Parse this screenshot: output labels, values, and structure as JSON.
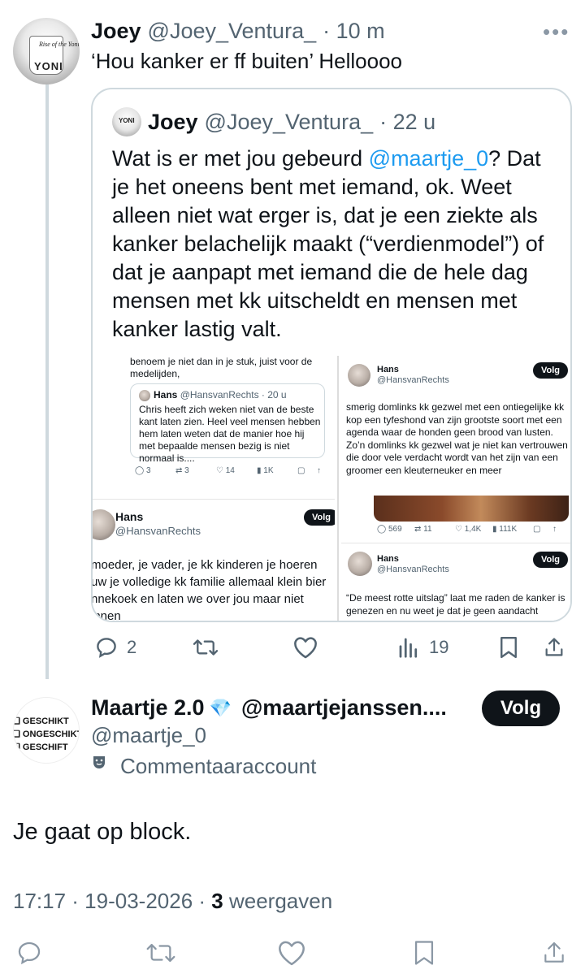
{
  "tweet": {
    "name": "Joey",
    "handle": "@Joey_Ventura_",
    "time": "· 10 m",
    "more_icon": "more-icon",
    "text": "‘Hou kanker er ff buiten’ Helloooo",
    "avatar_text": "YONI",
    "avatar_small_text": "Rise of the Yoni"
  },
  "quote": {
    "name": "Joey",
    "handle": "@Joey_Ventura_",
    "time": "· 22 u",
    "avatar_text": "YONI",
    "text_before": "Wat is er met jou gebeurd ",
    "mention": "@maartje_0",
    "text_after": "? Dat je het oneens bent met iemand, ok. Weet alleen niet wat erger is, dat je een ziekte als kanker belachelijk maakt (“verdienmodel”) of dat je aanpapt met iemand die de hele dag mensen met kk uitscheldt en mensen met kanker lastig valt.",
    "media": {
      "panelA": {
        "top_text": "benoem je niet dan in je stuk, juist voor de medelijden,",
        "inner_name": "Hans",
        "inner_handle": "@HansvanRechts · 20 u",
        "inner_text": "Chris heeft zich weken niet van de beste kant laten zien. Heel veel mensen hebben hem laten weten dat de manier hoe hij met bepaalde mensen bezig is niet normaal is....",
        "stats": [
          "3",
          "3",
          "14",
          "1K"
        ]
      },
      "panelB": {
        "name": "Hans",
        "handle": "@HansvanRechts",
        "button": "Volg",
        "text": "moeder, je vader, je kk kinderen je hoeren uw je volledige kk familie allemaal klein bier nnekoek en laten we over jou maar niet innen"
      },
      "panelC": {
        "name": "Hans",
        "handle": "@HansvanRechts",
        "button": "Volg",
        "text": "smerig domlinks kk gezwel met een ontiegelijke kk kop een tyfeshond van zijn grootste soort met een agenda waar de honden geen brood van lusten. Zo’n domlinks kk gezwel wat je niet kan vertrouwen die door vele verdacht wordt van het zijn van een groomer een kleuterneuker en meer",
        "stats": [
          "569",
          "11",
          "1,4K",
          "111K"
        ]
      },
      "panelD": {
        "name": "Hans",
        "handle": "@HansvanRechts",
        "button": "Volg",
        "text": "“De meest rotte uitslag” laat me raden de kanker is genezen en nu weet je dat je geen aandacht"
      }
    }
  },
  "actions": {
    "reply_count": "2",
    "retweet_count": "",
    "views_count": "19"
  },
  "reply_user": {
    "name": "Maartje 2.0",
    "emoji": "💎",
    "handle_long": "@maartjejanssen....",
    "handle": "@maartje_0",
    "badge_icon": "theater-mask-icon",
    "badge_text": "Commentaaraccount",
    "follow_label": "Volg",
    "avatar_lines": [
      "GESCHIKT",
      "ONGESCHIKT",
      "GESCHIFT"
    ]
  },
  "reply": {
    "text": "Je gaat op block."
  },
  "meta": {
    "time": "17:17 · 19-03-2026 · ",
    "views_number": "3",
    "views_label": " weergaven"
  },
  "colors": {
    "link": "#1d9bf0",
    "text": "#0f1419",
    "secondary": "#536471",
    "border": "#cfd9de"
  }
}
